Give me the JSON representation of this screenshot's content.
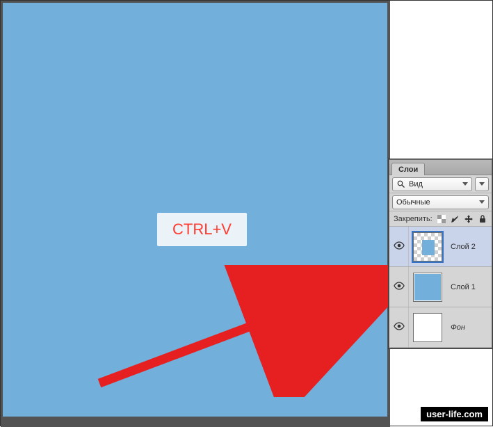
{
  "canvas": {
    "hint": "CTRL+V"
  },
  "layers_panel": {
    "tab_label": "Слои",
    "kind_dropdown": "Вид",
    "blend_mode": "Обычные",
    "lock_label": "Закрепить:",
    "layers": [
      {
        "name": "Слой 2",
        "visible": true,
        "selected": true,
        "thumb_type": "checker-blue"
      },
      {
        "name": "Слой 1",
        "visible": true,
        "selected": false,
        "thumb_type": "blue"
      },
      {
        "name": "Фон",
        "visible": true,
        "selected": false,
        "thumb_type": "white",
        "locked": true
      }
    ]
  },
  "watermark": "user-life.com"
}
